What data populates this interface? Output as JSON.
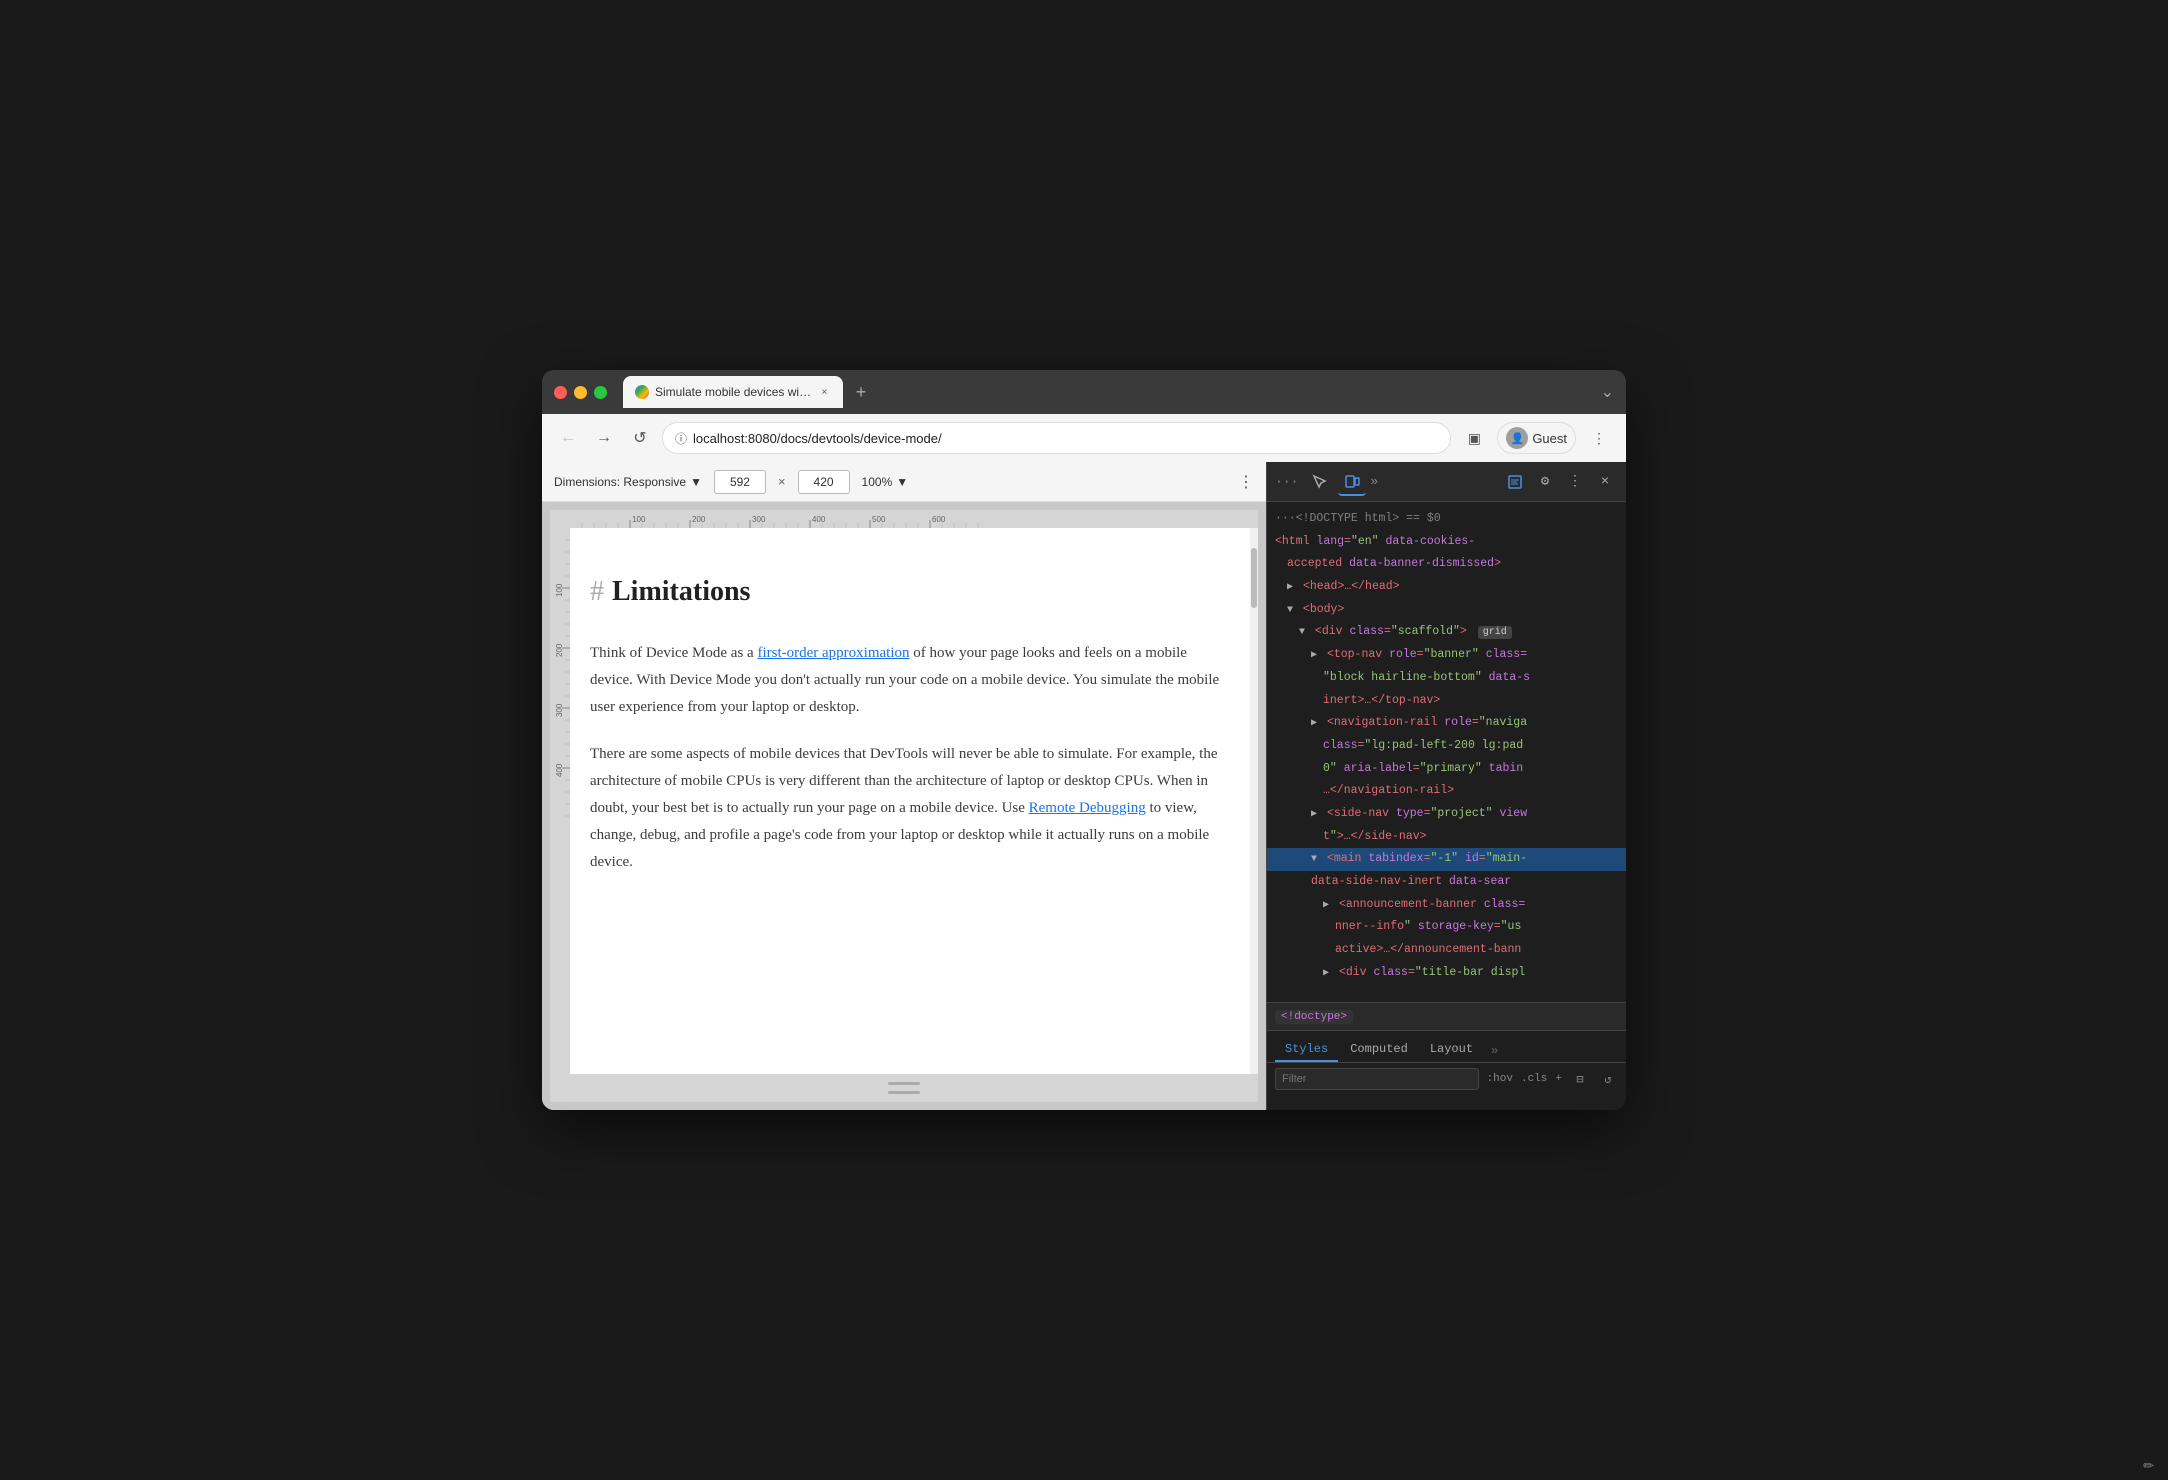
{
  "browser": {
    "traffic_lights": [
      "red",
      "yellow",
      "green"
    ],
    "tab": {
      "favicon_alt": "Chrome",
      "label": "Simulate mobile devices with D",
      "close_icon": "×"
    },
    "new_tab_icon": "+",
    "dropdown_icon": "⌄",
    "nav": {
      "back_icon": "←",
      "forward_icon": "→",
      "reload_icon": "↺",
      "url": "localhost:8080/docs/devtools/device-mode/",
      "lock_icon": "ⓘ"
    },
    "toolbar": {
      "sidebar_icon": "▣",
      "profile_icon": "👤",
      "profile_label": "Guest",
      "more_icon": "⋮"
    }
  },
  "device_toolbar": {
    "dimensions_label": "Dimensions: Responsive",
    "dropdown_icon": "▼",
    "width": "592",
    "height": "420",
    "separator": "×",
    "zoom": "100%",
    "zoom_icon": "▼",
    "more_icon": "⋮"
  },
  "page": {
    "heading_hash": "#",
    "heading": "Limitations",
    "paragraph1_before": "Think of Device Mode as a ",
    "paragraph1_link": "first-order approximation",
    "paragraph1_after": " of how your page looks and feels on a mobile device. With Device Mode you don't actually run your code on a mobile device. You simulate the mobile user experience from your laptop or desktop.",
    "paragraph2_before": "There are some aspects of mobile devices that DevTools will never be able to simulate. For example, the architecture of mobile CPUs is very different than the architecture of laptop or desktop CPUs. When in doubt, your best bet is to actually run your page on a mobile device. Use ",
    "paragraph2_link": "Remote Debugging",
    "paragraph2_after": " to view, change, debug, and profile a page's code from your laptop or desktop while it actually runs on a mobile device."
  },
  "devtools": {
    "toolbar": {
      "dots": "···",
      "inspect_icon": "⬚",
      "device_icon": "⧠",
      "more_tabs_icon": "»",
      "console_icon": "≡",
      "settings_icon": "⚙",
      "more_icon": "⋮",
      "close_icon": "×"
    },
    "dom": {
      "lines": [
        {
          "indent": 0,
          "text": "···<!DOCTYPE html> == $0",
          "class": "c-gray"
        },
        {
          "indent": 0,
          "content": "<html lang=\"en\" data-cookies-accepted data-banner-dismissed>",
          "class": "c-pink"
        },
        {
          "indent": 1,
          "triangle": "▶",
          "content": "<head>…</head>",
          "class": "c-pink"
        },
        {
          "indent": 1,
          "triangle": "▼",
          "content": "<body>",
          "class": "c-pink"
        },
        {
          "indent": 2,
          "triangle": "▼",
          "content": "<div class=\"scaffold\">",
          "class": "c-pink",
          "badge": "grid"
        },
        {
          "indent": 3,
          "triangle": "▶",
          "content": "<top-nav role=\"banner\" class=",
          "class": "c-pink",
          "overflow": "block hairline-bottom\" data-s"
        },
        {
          "indent": 4,
          "content": "inert>…</top-nav>",
          "class": "c-pink"
        },
        {
          "indent": 3,
          "triangle": "▶",
          "content": "<navigation-rail role=\"naviga",
          "class": "c-pink",
          "overflow": "class=\"lg:pad-left-200 lg:pad"
        },
        {
          "indent": 4,
          "content": "0\" aria-label=\"primary\" tabin",
          "class": "c-pink"
        },
        {
          "indent": 4,
          "content": "…</navigation-rail>",
          "class": "c-pink"
        },
        {
          "indent": 3,
          "triangle": "▶",
          "content": "<side-nav type=\"project\" view",
          "class": "c-pink",
          "overflow": "t\">…</side-nav>"
        },
        {
          "indent": 3,
          "triangle": "▼",
          "content": "<main tabindex=\"-1\" id=\"main-",
          "class": "c-pink",
          "overflow": "data-side-nav-inert data-sear"
        },
        {
          "indent": 4,
          "triangle": "▶",
          "content": "<announcement-banner class=",
          "class": "c-pink",
          "overflow": "nner--info\" storage-key=\"us"
        },
        {
          "indent": 5,
          "content": "active>…</announcement-bann",
          "class": "c-pink"
        },
        {
          "indent": 4,
          "triangle": "▶",
          "content": "<div class=\"title-bar displ",
          "class": "c-pink"
        }
      ]
    },
    "status": {
      "doctype_label": "<!doctype>"
    },
    "styles": {
      "tabs": [
        {
          "label": "Styles",
          "active": true
        },
        {
          "label": "Computed",
          "active": false
        },
        {
          "label": "Layout",
          "active": false
        }
      ],
      "more_label": "»",
      "filter_placeholder": "Filter",
      "hov_label": ":hov",
      "cls_label": ".cls",
      "plus_label": "+",
      "layer_icon": "⊟",
      "refresh_icon": "↺"
    }
  }
}
